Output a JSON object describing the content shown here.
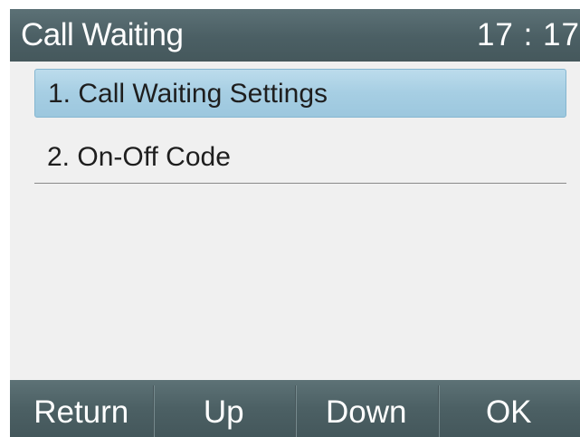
{
  "status_bar": {
    "title": "Call Waiting",
    "clock": "17 : 17"
  },
  "menu": {
    "items": [
      {
        "label": "1. Call Waiting Settings",
        "selected": true
      },
      {
        "label": "2. On-Off Code",
        "selected": false
      }
    ]
  },
  "softkeys": {
    "return_label": "Return",
    "up_label": "Up",
    "down_label": "Down",
    "ok_label": "OK"
  },
  "colors": {
    "bar": "#4b5f64",
    "selection": "#a6cee3",
    "background": "#f0f0f0"
  }
}
